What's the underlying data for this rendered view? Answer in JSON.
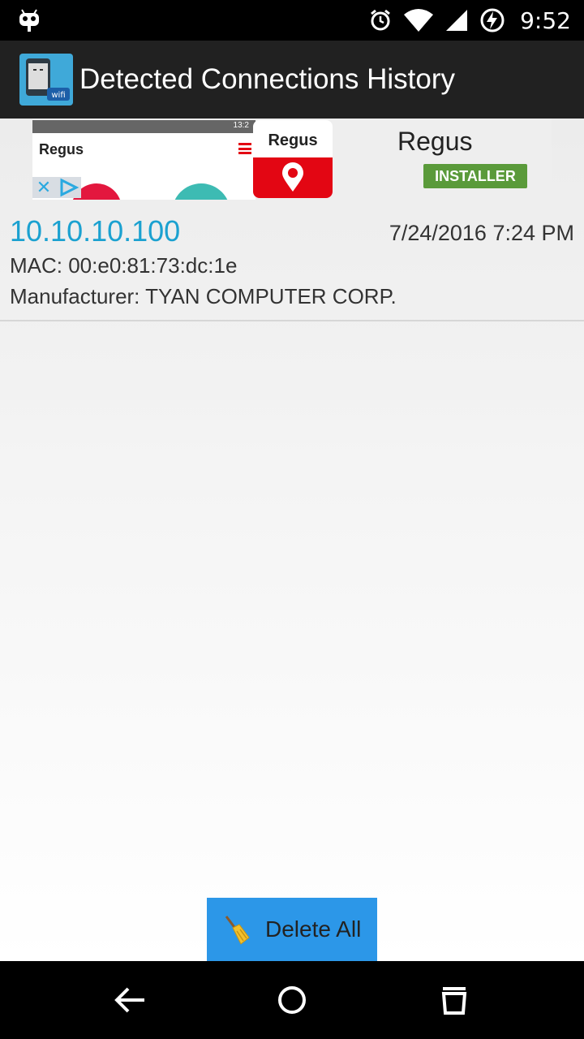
{
  "status_bar": {
    "time": "9:52",
    "icons": [
      "android-debug-icon",
      "alarm-icon",
      "wifi-icon",
      "signal-icon",
      "battery-charging-icon"
    ]
  },
  "app_bar": {
    "title": "Detected Connections History",
    "icon": "wifi-phone-app-icon"
  },
  "ad": {
    "preview_time": "13:2",
    "preview_logo": "Regus",
    "tile_logo": "Regus",
    "brand": "Regus",
    "install_label": "INSTALLER",
    "colors": {
      "brand_red": "#e30613",
      "install_green": "#5a9a3a"
    }
  },
  "connections": [
    {
      "ip": "10.10.10.100",
      "date": "7/24/2016 7:24 PM",
      "mac": "MAC: 00:e0:81:73:dc:1e",
      "manufacturer": "Manufacturer: TYAN COMPUTER CORP."
    }
  ],
  "actions": {
    "delete_all_label": "Delete All",
    "delete_all_icon": "broom-icon"
  },
  "nav_bar": {
    "items": [
      "back-icon",
      "home-icon",
      "recents-icon"
    ]
  },
  "colors": {
    "accent": "#1ba1d0",
    "button": "#2c97e8",
    "app_bar": "#212121"
  }
}
